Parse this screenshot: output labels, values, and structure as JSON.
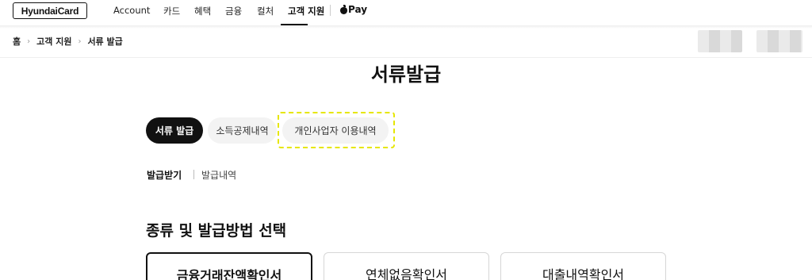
{
  "nav": {
    "logo": "HyundaiCard",
    "items": [
      "Account",
      "카드",
      "혜택",
      "금융",
      "컬처",
      "고객 지원"
    ],
    "active_index": 5,
    "apple_pay": "Pay"
  },
  "breadcrumb": [
    "홈",
    "고객 지원",
    "서류 발급"
  ],
  "page_title": "서류발급",
  "tabs": [
    {
      "label": "서류 발급",
      "active": true
    },
    {
      "label": "소득공제내역",
      "active": false
    },
    {
      "label": "개인사업자 이용내역",
      "active": false,
      "highlighted": true
    }
  ],
  "subtabs": [
    {
      "label": "발급받기",
      "active": true
    },
    {
      "label": "발급내역",
      "active": false
    }
  ],
  "section_heading": "종류 및 발급방법 선택",
  "doc_types": [
    {
      "label": "금융거래잔액확인서",
      "selected": true
    },
    {
      "label": "연체없음확인서",
      "selected": false
    },
    {
      "label": "대출내역확인서",
      "selected": false
    }
  ],
  "colors": {
    "accent": "#111111",
    "highlight": "#e6e600",
    "tab_inactive_bg": "#f3f3f3"
  }
}
